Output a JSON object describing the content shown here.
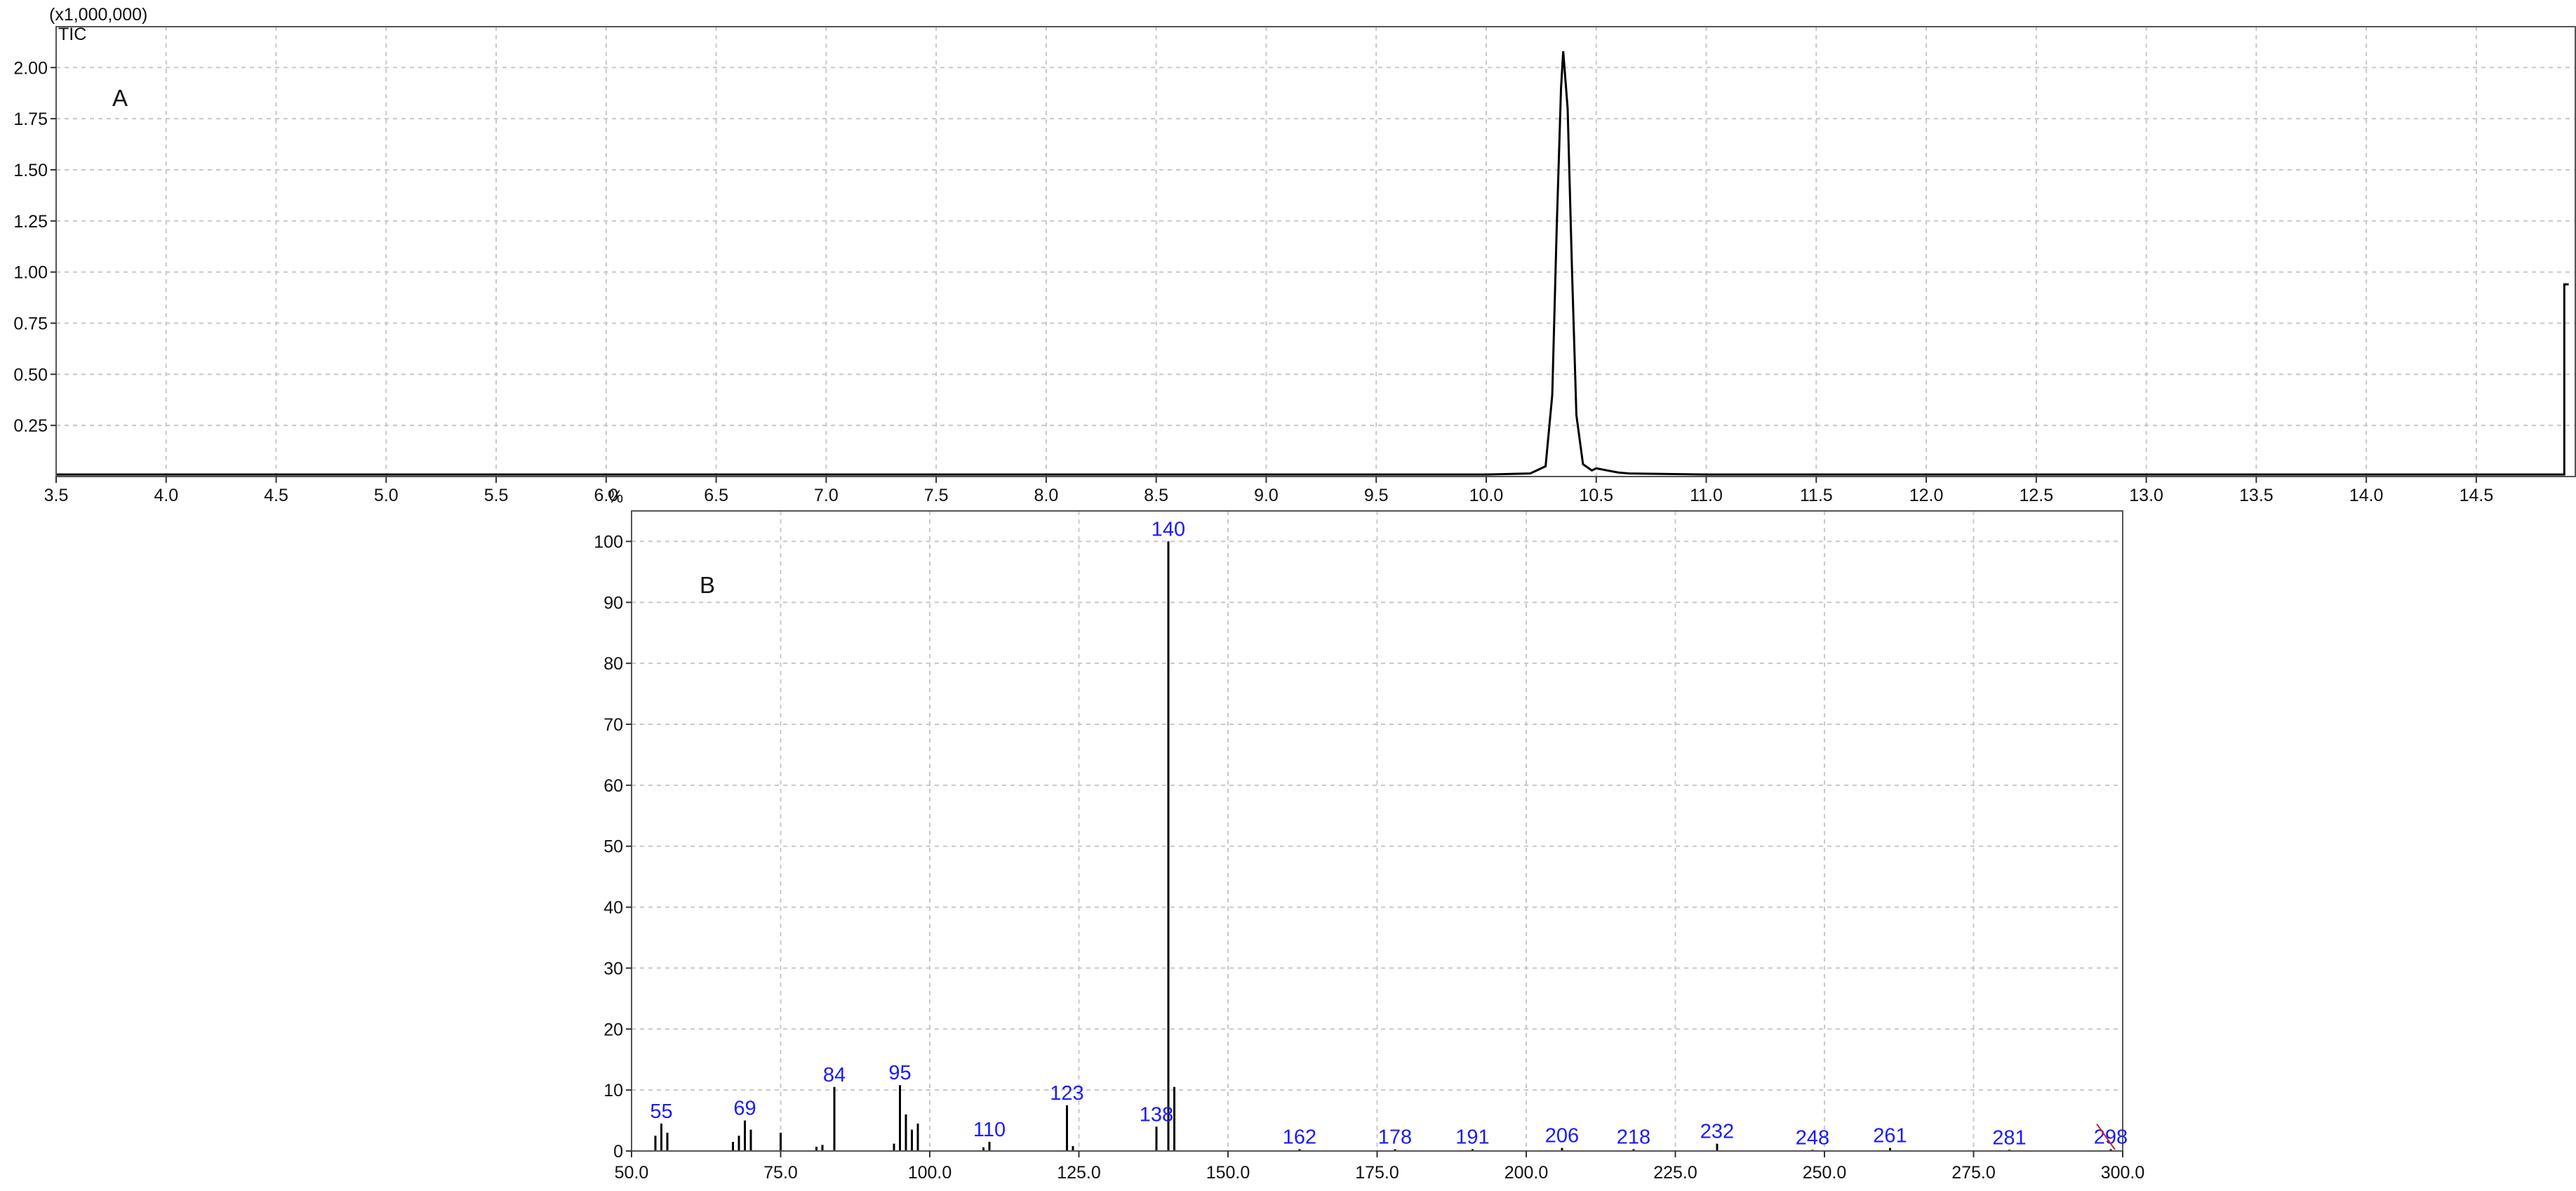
{
  "chart_data": [
    {
      "type": "line",
      "panel_label": "A",
      "trace_label": "TIC",
      "y_multiplier": "(x1,000,000)",
      "xlim": [
        3.5,
        14.95
      ],
      "ylim": [
        0,
        2.2
      ],
      "x_ticks": [
        "3.5",
        "4.0",
        "4.5",
        "5.0",
        "5.5",
        "6.0",
        "6.5",
        "7.0",
        "7.5",
        "8.0",
        "8.5",
        "9.0",
        "9.5",
        "10.0",
        "10.5",
        "11.0",
        "11.5",
        "12.0",
        "12.5",
        "13.0",
        "13.5",
        "14.0",
        "14.5"
      ],
      "y_ticks": [
        "0.25",
        "0.50",
        "0.75",
        "1.00",
        "1.25",
        "1.50",
        "1.75",
        "2.00"
      ],
      "grid": true,
      "series": [
        {
          "color": "#000000",
          "x": [
            3.5,
            6.0,
            8.0,
            10.0,
            10.2,
            10.27,
            10.3,
            10.32,
            10.34,
            10.35,
            10.37,
            10.39,
            10.41,
            10.44,
            10.48,
            10.5,
            10.55,
            10.6,
            10.65,
            11.0,
            12.0,
            13.0,
            14.0,
            14.9,
            14.9,
            14.92
          ],
          "y": [
            0.01,
            0.01,
            0.01,
            0.01,
            0.015,
            0.05,
            0.4,
            1.2,
            1.9,
            2.08,
            1.8,
            1.0,
            0.3,
            0.06,
            0.03,
            0.04,
            0.03,
            0.02,
            0.015,
            0.01,
            0.01,
            0.01,
            0.01,
            0.01,
            0.94,
            0.94
          ]
        }
      ]
    },
    {
      "type": "bar",
      "panel_label": "B",
      "y_unit": "%",
      "xlim": [
        50,
        300
      ],
      "ylim": [
        0,
        105
      ],
      "x_ticks": [
        "50.0",
        "75.0",
        "100.0",
        "125.0",
        "150.0",
        "175.0",
        "200.0",
        "225.0",
        "250.0",
        "275.0",
        "300.0"
      ],
      "y_ticks": [
        "0",
        "10",
        "20",
        "30",
        "40",
        "50",
        "60",
        "70",
        "80",
        "90",
        "100"
      ],
      "grid": true,
      "peaks": [
        {
          "mz": 54,
          "intensity": 2.5
        },
        {
          "mz": 55,
          "intensity": 4.5,
          "label": "55"
        },
        {
          "mz": 56,
          "intensity": 3
        },
        {
          "mz": 67,
          "intensity": 1.5
        },
        {
          "mz": 68,
          "intensity": 2.5
        },
        {
          "mz": 69,
          "intensity": 5,
          "label": "69"
        },
        {
          "mz": 70,
          "intensity": 3.5
        },
        {
          "mz": 75,
          "intensity": 3
        },
        {
          "mz": 81,
          "intensity": 0.7
        },
        {
          "mz": 82,
          "intensity": 1
        },
        {
          "mz": 84,
          "intensity": 10.5,
          "label": "84"
        },
        {
          "mz": 94,
          "intensity": 1.2
        },
        {
          "mz": 95,
          "intensity": 10.8,
          "label": "95"
        },
        {
          "mz": 96,
          "intensity": 6
        },
        {
          "mz": 97,
          "intensity": 3.5
        },
        {
          "mz": 98,
          "intensity": 4.5
        },
        {
          "mz": 109,
          "intensity": 0.6
        },
        {
          "mz": 110,
          "intensity": 1.5,
          "label": "110"
        },
        {
          "mz": 123,
          "intensity": 7.5,
          "label": "123"
        },
        {
          "mz": 124,
          "intensity": 0.8
        },
        {
          "mz": 138,
          "intensity": 4,
          "label": "138"
        },
        {
          "mz": 140,
          "intensity": 100,
          "label": "140"
        },
        {
          "mz": 141,
          "intensity": 10.5
        },
        {
          "mz": 162,
          "intensity": 0.3,
          "label": "162"
        },
        {
          "mz": 178,
          "intensity": 0.3,
          "label": "178"
        },
        {
          "mz": 191,
          "intensity": 0.3,
          "label": "191"
        },
        {
          "mz": 206,
          "intensity": 0.5,
          "label": "206"
        },
        {
          "mz": 218,
          "intensity": 0.3,
          "label": "218"
        },
        {
          "mz": 232,
          "intensity": 1.2,
          "label": "232"
        },
        {
          "mz": 248,
          "intensity": 0.2,
          "label": "248"
        },
        {
          "mz": 261,
          "intensity": 0.5,
          "label": "261"
        },
        {
          "mz": 281,
          "intensity": 0.2,
          "label": "281"
        },
        {
          "mz": 298,
          "intensity": 0.3,
          "label": "298"
        }
      ],
      "label_color": "#1a1aff",
      "marker_color": "#cc2222"
    }
  ]
}
